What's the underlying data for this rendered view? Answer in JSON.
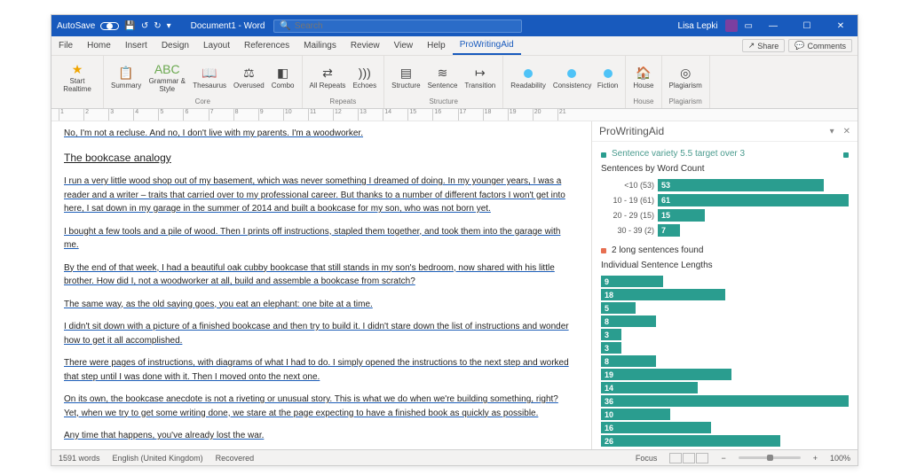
{
  "titlebar": {
    "autosave": "AutoSave",
    "doc_title": "Document1 - Word",
    "search_placeholder": "Search",
    "username": "Lisa Lepki"
  },
  "menu": {
    "tabs": [
      "File",
      "Home",
      "Insert",
      "Design",
      "Layout",
      "References",
      "Mailings",
      "Review",
      "View",
      "Help",
      "ProWritingAid"
    ],
    "share": "Share",
    "comments": "Comments"
  },
  "ribbon": {
    "start_realtime": "Start Realtime",
    "summary": "Summary",
    "grammar_style": "Grammar & Style",
    "thesaurus": "Thesaurus",
    "overused": "Overused",
    "combo": "Combo",
    "all_repeats": "All Repeats",
    "echoes": "Echoes",
    "structure": "Structure",
    "sentence": "Sentence",
    "transition": "Transition",
    "readability": "Readability",
    "consistency": "Consistency",
    "fiction": "Fiction",
    "house": "House",
    "plagiarism": "Plagiarism",
    "group_core": "Core",
    "group_repeats": "Repeats",
    "group_structure": "Structure",
    "group_house": "House",
    "group_plagiarism": "Plagiarism"
  },
  "doc": {
    "p0": "No, I'm not a recluse. And no, I don't live with my parents. I'm a woodworker.",
    "title": "The bookcase analogy",
    "p1": "I run a very little wood shop out of my basement, which was never something I dreamed of doing. In my younger years, I was a reader and a writer – traits that carried over to my professional career. But thanks to a number of different factors I won't get into here, I sat down in my garage in the summer of 2014 and built a bookcase for my son, who was not born yet.",
    "p2": "I bought a few tools and a pile of wood. Then I prints off instructions, stapled them together, and took them into the garage with me.",
    "p3": "By the end of that week, I had a beautiful oak cubby bookcase that still stands in my son's bedroom, now shared with his little brother. How did I, not a woodworker at all, build and assemble a bookcase from scratch?",
    "p4": "The same way, as the old saying goes, you eat an elephant: one bite at a time.",
    "p5": "I didn't sit down with a picture of a finished bookcase and then try to build it. I didn't stare down the list of instructions and wonder how to get it all accomplished.",
    "p6": "There were pages of instructions, with diagrams of what I had to do. I simply opened the instructions to the next step and worked that step until I was done with it. Then I moved onto the next one.",
    "p7": "On its own, the bookcase anecdote is not a riveting or unusual story. This is what we do when we're building something, right? Yet, when we try to get some writing done, we stare at the page expecting to have a finished book as quickly as possible.",
    "p8": "Any time that happens, you've already lost the war."
  },
  "pane": {
    "title": "ProWritingAid",
    "summary": "Sentence variety 5.5 target over 3",
    "section1": "Sentences by Word Count",
    "alert": "2 long sentences found",
    "section2": "Individual Sentence Lengths"
  },
  "chart_data": [
    {
      "type": "bar",
      "title": "Sentences by Word Count",
      "categories": [
        "<10",
        "10 - 19",
        "20 - 29",
        "30 - 39"
      ],
      "values": [
        53,
        61,
        15,
        7
      ],
      "counts": [
        53,
        61,
        15,
        2
      ],
      "xlabel": "",
      "ylabel": ""
    },
    {
      "type": "bar",
      "title": "Individual Sentence Lengths",
      "values": [
        9,
        18,
        5,
        8,
        3,
        3,
        8,
        19,
        14,
        36,
        10,
        16,
        26
      ],
      "xlabel": "",
      "ylabel": ""
    }
  ],
  "status": {
    "words": "1591 words",
    "lang": "English (United Kingdom)",
    "recovered": "Recovered",
    "focus": "Focus",
    "zoom": "100%"
  },
  "colors": {
    "ribbon_blue": "#185abd",
    "teal": "#2a9d8f",
    "orange": "#e76f51"
  }
}
